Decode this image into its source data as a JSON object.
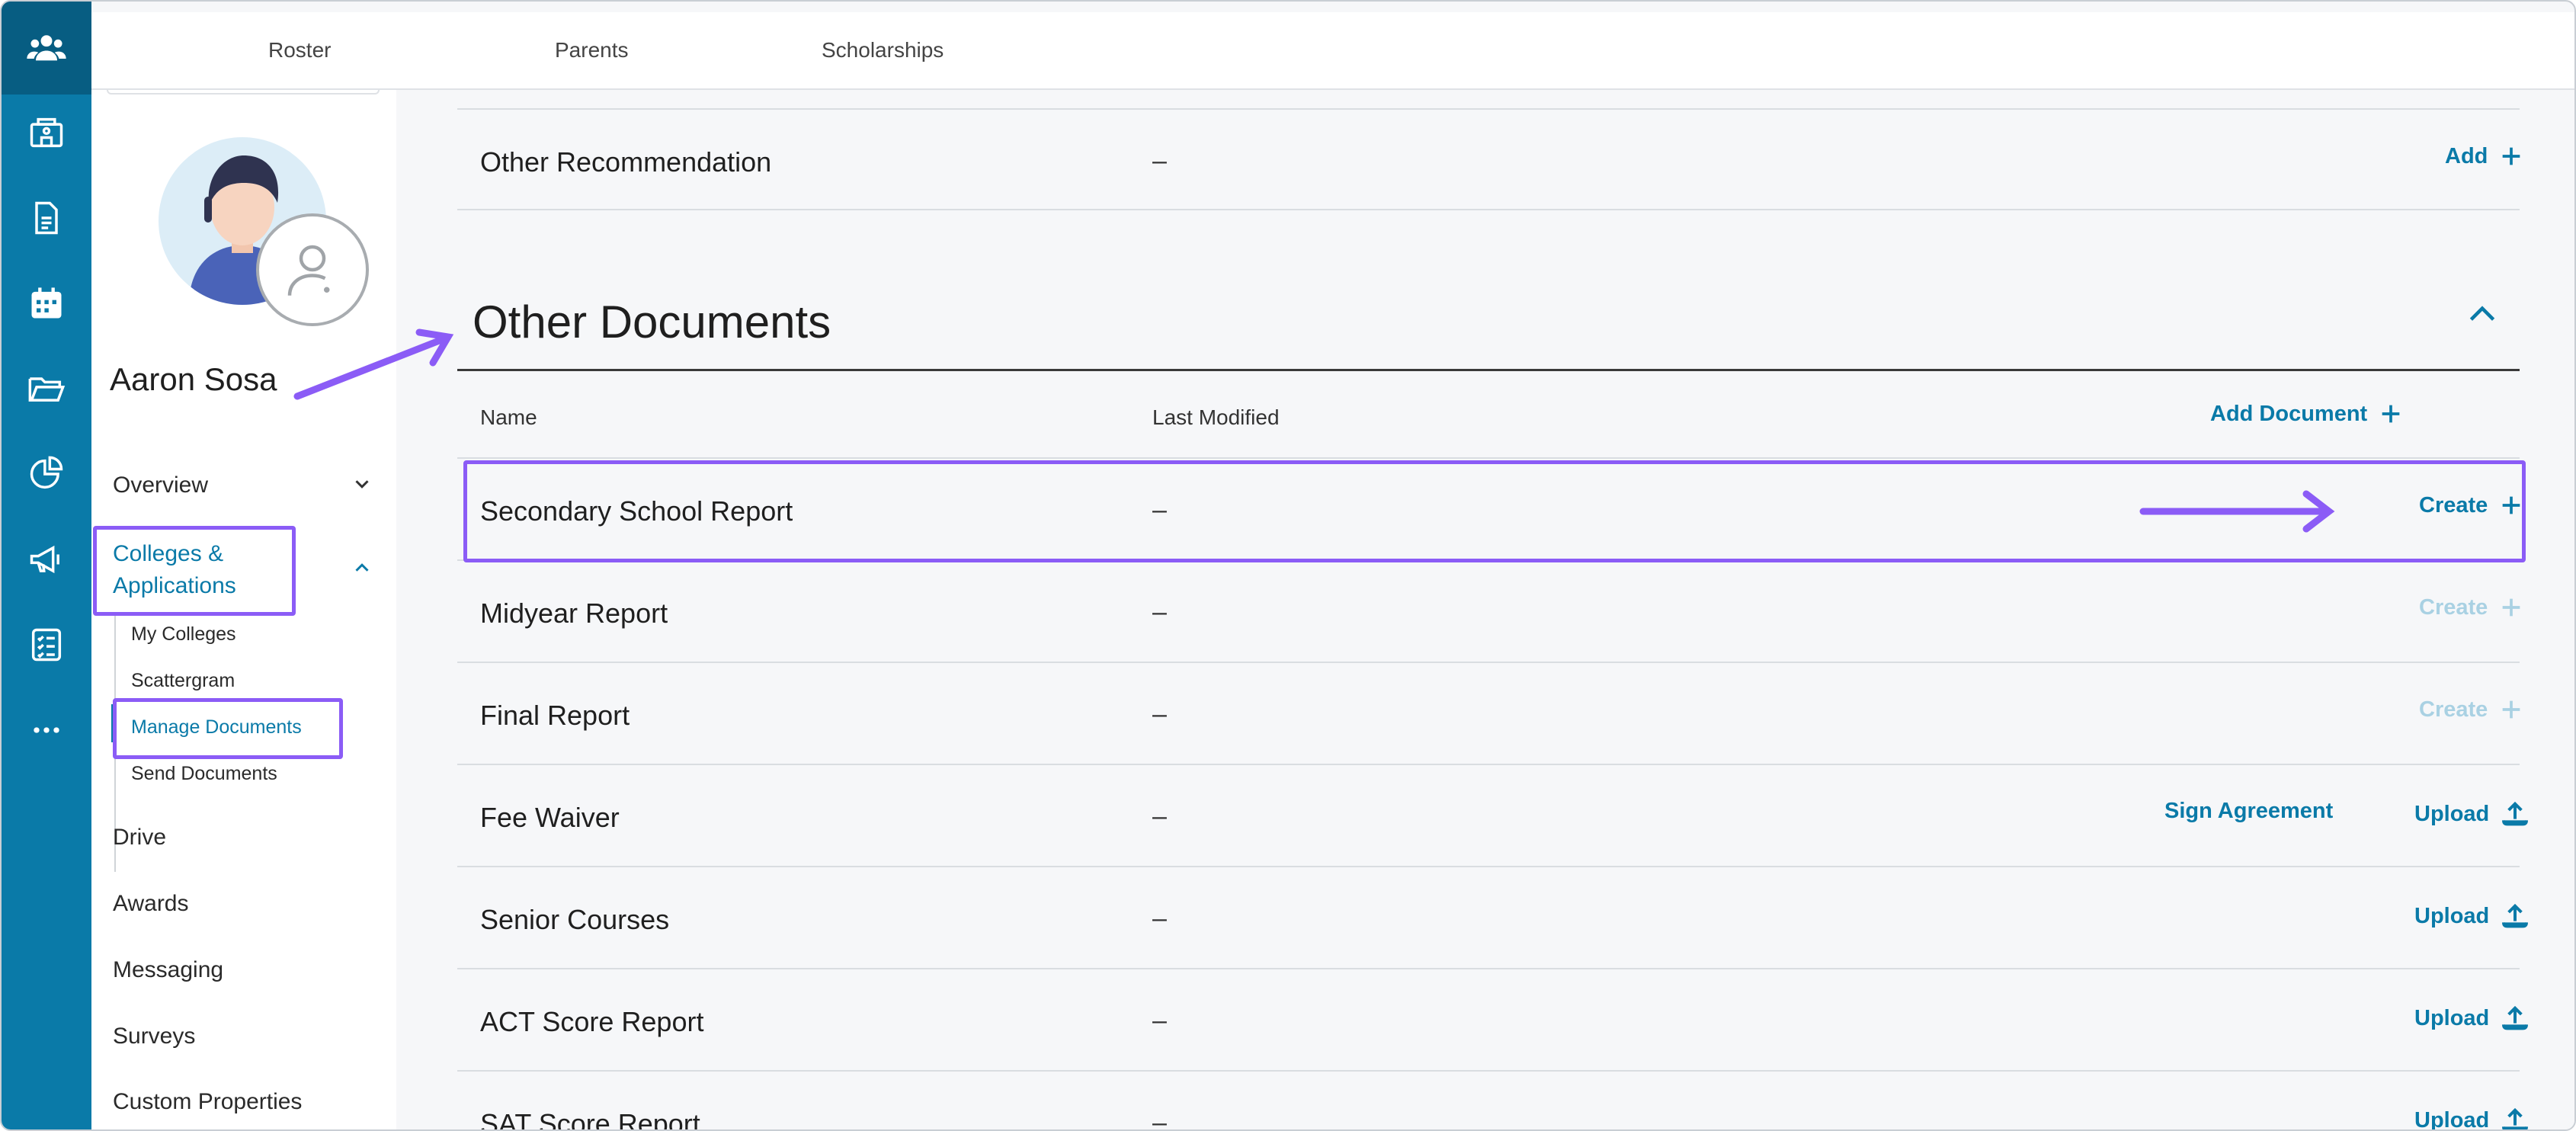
{
  "topnav": {
    "tabs": [
      {
        "label": "Roster"
      },
      {
        "label": "Parents"
      },
      {
        "label": "Scholarships"
      }
    ]
  },
  "rail": {
    "icons": [
      "people-icon",
      "school-icon",
      "document-icon",
      "calendar-icon",
      "folder-icon",
      "pie-chart-icon",
      "megaphone-icon",
      "checklist-icon",
      "more-icon"
    ]
  },
  "student": {
    "name": "Aaron Sosa"
  },
  "sidebar": {
    "overview": "Overview",
    "colleges_line1": "Colleges &",
    "colleges_line2": "Applications",
    "sub": {
      "my_colleges": "My Colleges",
      "scattergram": "Scattergram",
      "manage_documents": "Manage Documents",
      "send_documents": "Send Documents"
    },
    "drive": "Drive",
    "awards": "Awards",
    "messaging": "Messaging",
    "surveys": "Surveys",
    "custom_properties": "Custom Properties"
  },
  "recommendation_row": {
    "name": "Other Recommendation",
    "modified": "–",
    "action": "Add"
  },
  "other_documents": {
    "title": "Other Documents",
    "col_name": "Name",
    "col_modified": "Last Modified",
    "add_document": "Add Document",
    "rows": [
      {
        "name": "Secondary School Report",
        "modified": "–",
        "action": "Create"
      },
      {
        "name": "Midyear Report",
        "modified": "–",
        "action": "Create"
      },
      {
        "name": "Final Report",
        "modified": "–",
        "action": "Create"
      },
      {
        "name": "Fee Waiver",
        "modified": "–",
        "secondary_action": "Sign Agreement",
        "action": "Upload"
      },
      {
        "name": "Senior Courses",
        "modified": "–",
        "action": "Upload"
      },
      {
        "name": "ACT Score Report",
        "modified": "–",
        "action": "Upload"
      },
      {
        "name": "SAT Score Report",
        "modified": "–",
        "action": "Upload"
      }
    ]
  },
  "colors": {
    "brand": "#0a7aa8",
    "brand_dark": "#075d82",
    "annotation": "#8b5cf6",
    "disabled": "#a9d1e3"
  }
}
